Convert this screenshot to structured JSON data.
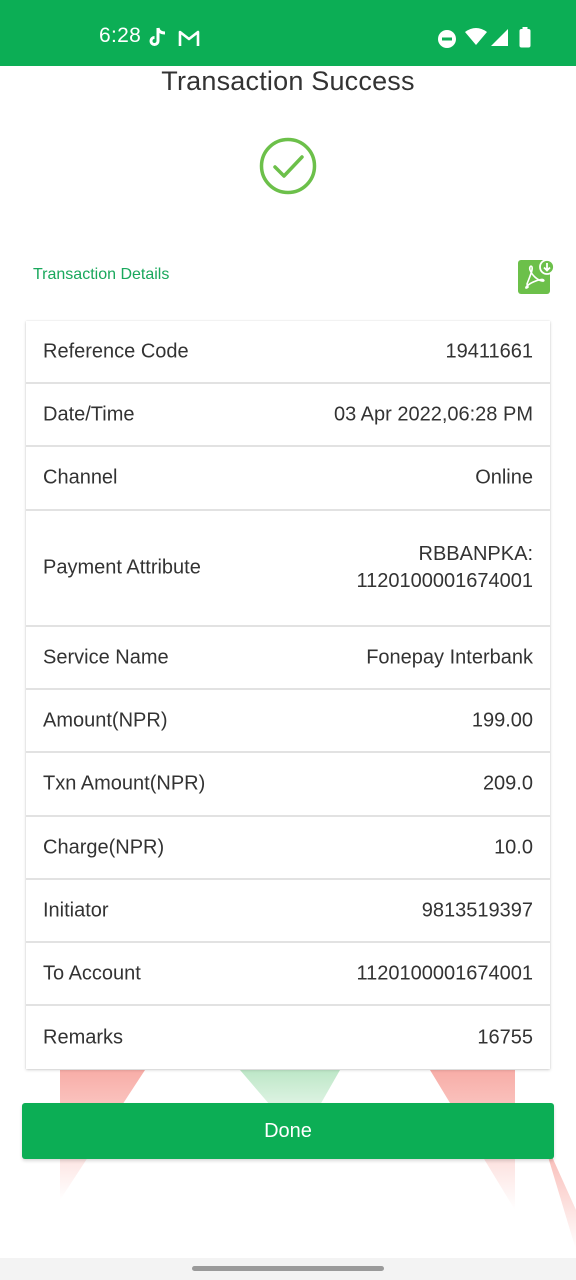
{
  "status_bar": {
    "time": "6:28",
    "icons": [
      "tiktok-icon",
      "gmail-icon",
      "do-not-disturb-icon",
      "wifi-icon",
      "signal-icon",
      "battery-icon"
    ],
    "color": "#0cae55"
  },
  "header": {
    "title": "Transaction Success"
  },
  "success_icon": "check-circle-icon",
  "details": {
    "label": "Transaction Details",
    "download_icon": "pdf-download-icon",
    "rows": [
      {
        "label": "Reference Code",
        "value": "19411661"
      },
      {
        "label": "Date/Time",
        "value": "03 Apr 2022,06:28 PM"
      },
      {
        "label": "Channel",
        "value": "Online"
      },
      {
        "label": "Payment Attribute",
        "value_line1": "RBBANPKA:",
        "value_line2": "1120100001674001"
      },
      {
        "label": "Service Name",
        "value": "Fonepay Interbank"
      },
      {
        "label": "Amount(NPR)",
        "value": "199.00"
      },
      {
        "label": "Txn Amount(NPR)",
        "value": "209.0"
      },
      {
        "label": "Charge(NPR)",
        "value": "10.0"
      },
      {
        "label": "Initiator",
        "value": "9813519397"
      },
      {
        "label": "To Account",
        "value": "1120100001674001"
      },
      {
        "label": "Remarks",
        "value": "16755"
      }
    ]
  },
  "done_button": {
    "label": "Done"
  },
  "colors": {
    "accent": "#0cae55",
    "details_label": "#19a85c",
    "check": "#6cc04a"
  }
}
